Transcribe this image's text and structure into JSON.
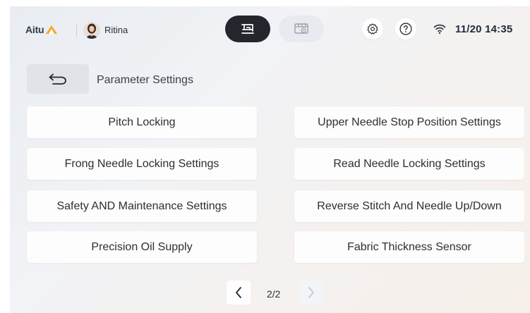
{
  "header": {
    "logo_text": "Aitu",
    "user_name": "Ritina",
    "mode_tabs": [
      {
        "icon": "sewing-machine-icon",
        "active": true
      },
      {
        "icon": "video-playback-icon",
        "active": false
      }
    ],
    "settings_icon": "gear-icon",
    "help_icon": "help-icon",
    "wifi_icon": "wifi-icon",
    "datetime": "11/20 14:35"
  },
  "title_row": {
    "back_icon": "back-arrow-icon",
    "title": "Parameter Settings"
  },
  "settings": [
    {
      "label": "Pitch Locking"
    },
    {
      "label": "Upper Needle Stop Position Settings"
    },
    {
      "label": "Frong Needle Locking Settings"
    },
    {
      "label": "Read Needle Locking Settings"
    },
    {
      "label": "Safety AND Maintenance Settings"
    },
    {
      "label": "Reverse Stitch And Needle Up/Down"
    },
    {
      "label": "Precision Oil Supply"
    },
    {
      "label": "Fabric Thickness Sensor"
    }
  ],
  "pagination": {
    "page_indicator": "2/2",
    "prev_icon": "chevron-left-icon",
    "next_icon": "chevron-right-icon"
  },
  "colors": {
    "accent_orange": "#f5a623",
    "active_tab_bg": "#23262c",
    "logo_text": "#2f3a4a"
  }
}
